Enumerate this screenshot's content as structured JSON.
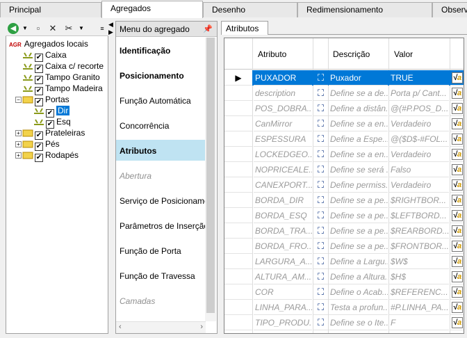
{
  "tabs": [
    "Principal",
    "Agregados",
    "Desenho",
    "Redimensionamento",
    "Observ"
  ],
  "active_tab": "Agregados",
  "toolbar": {
    "icons": [
      "back-icon",
      "dropdown-icon",
      "new-icon",
      "delete-icon",
      "cut-icon",
      "dropdown-icon",
      "overflow-icon"
    ]
  },
  "tree": {
    "root_badge": "AGR",
    "root": "Agregados locais",
    "items": [
      {
        "label": "Caixa",
        "checked": true
      },
      {
        "label": "Caixa c/ recorte",
        "checked": true
      },
      {
        "label": "Tampo Granito",
        "checked": true
      },
      {
        "label": "Tampo Madeira",
        "checked": true
      },
      {
        "label": "Portas",
        "checked": true
      },
      {
        "label": "Dir",
        "checked": true
      },
      {
        "label": "Esq",
        "checked": true
      },
      {
        "label": "Prateleiras",
        "checked": true
      },
      {
        "label": "Pés",
        "checked": true
      },
      {
        "label": "Rodapés",
        "checked": true
      }
    ]
  },
  "menu": {
    "title": "Menu do agregado",
    "items": [
      "Identificação",
      "Posicionamento",
      "Função Automática",
      "Concorrência",
      "Atributos",
      "Abertura",
      "Serviço de Posicionamento",
      "Parâmetros de Inserção",
      "Função de Porta",
      "Função de Travessa",
      "Camadas"
    ]
  },
  "attributes": {
    "tab": "Atributos",
    "headers": [
      "Atributo",
      "Descrição",
      "Valor"
    ],
    "rows": [
      {
        "name": "PUXADOR",
        "desc": "Puxador",
        "value": "TRUE"
      },
      {
        "name": "description",
        "desc": "Define se a de...",
        "value": "Porta p/ Cant..."
      },
      {
        "name": "POS_DOBRA...",
        "desc": "Define a distân...",
        "value": "@(#P.POS_D..."
      },
      {
        "name": "CanMirror",
        "desc": "Define se a en...",
        "value": "Verdadeiro"
      },
      {
        "name": "ESPESSURA",
        "desc": "Define a Espe...",
        "value": "@($D$-#FOL..."
      },
      {
        "name": "LOCKEDGEO...",
        "desc": "Define se a en...",
        "value": "Verdadeiro"
      },
      {
        "name": "NOPRICEALE...",
        "desc": "Define se será ...",
        "value": "Falso"
      },
      {
        "name": "CANEXPORT...",
        "desc": "Define permiss...",
        "value": "Verdadeiro"
      },
      {
        "name": "BORDA_DIR",
        "desc": "Define se a pe...",
        "value": "$RIGHTBOR..."
      },
      {
        "name": "BORDA_ESQ",
        "desc": "Define se a pe...",
        "value": "$LEFTBORD..."
      },
      {
        "name": "BORDA_TRA...",
        "desc": "Define se a pe...",
        "value": "$REARBORD..."
      },
      {
        "name": "BORDA_FRO...",
        "desc": "Define se a pe...",
        "value": "$FRONTBOR..."
      },
      {
        "name": "LARGURA_A...",
        "desc": "Define a Largu...",
        "value": "$W$"
      },
      {
        "name": "ALTURA_AM...",
        "desc": "Define a Altura...",
        "value": "$H$"
      },
      {
        "name": "COR",
        "desc": "Define o Acab...",
        "value": "$REFERENC..."
      },
      {
        "name": "LINHA_PARA...",
        "desc": "Testa a profun...",
        "value": "#P.LINHA_PA..."
      },
      {
        "name": "TIPO_PRODU...",
        "desc": "Define se o Ite...",
        "value": "F"
      }
    ]
  },
  "colors": {
    "selection": "#0078d7",
    "menu_selected": "#bfe3f2"
  }
}
